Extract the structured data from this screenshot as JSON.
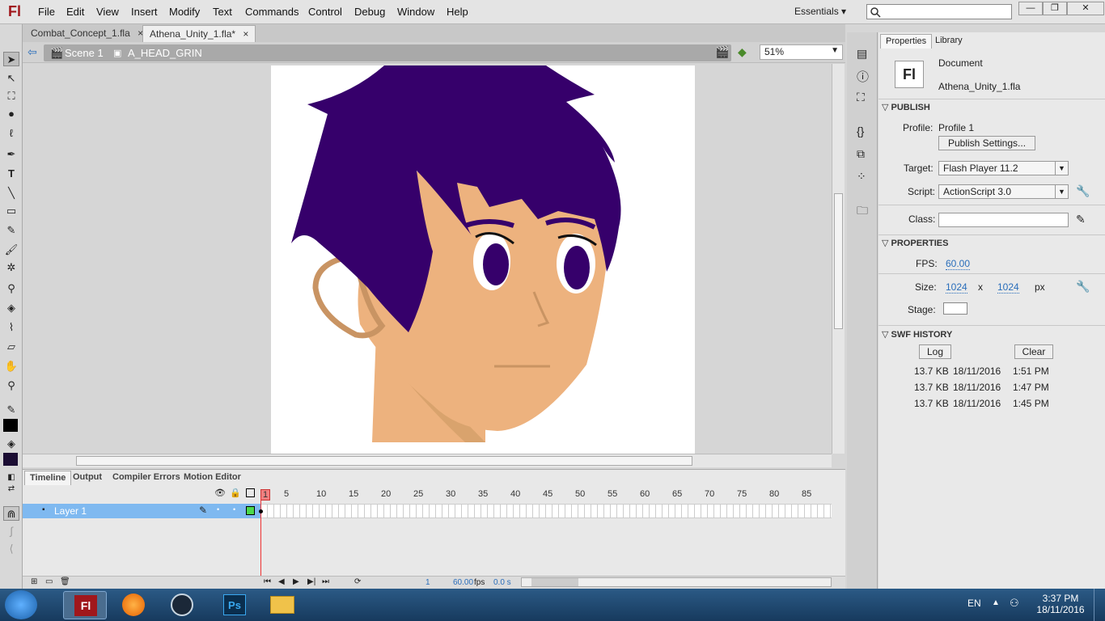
{
  "app": {
    "logo": "Fl"
  },
  "menu": [
    "File",
    "Edit",
    "View",
    "Insert",
    "Modify",
    "Text",
    "Commands",
    "Control",
    "Debug",
    "Window",
    "Help"
  ],
  "workspace": {
    "label": "Essentials"
  },
  "window_controls": {
    "minimize": "—",
    "restore": "❐",
    "close": "✕"
  },
  "tabs": [
    {
      "label": "Combat_Concept_1.fla",
      "close": "×"
    },
    {
      "label": "Athena_Unity_1.fla*",
      "close": "×"
    }
  ],
  "breadcrumb": {
    "scene": "Scene 1",
    "symbol": "A_HEAD_GRIN"
  },
  "zoom": {
    "value": "51%"
  },
  "timeline": {
    "tabs": [
      "Timeline",
      "Output",
      "Compiler Errors",
      "Motion Editor"
    ],
    "frame_numbers": [
      "1",
      "5",
      "10",
      "15",
      "20",
      "25",
      "30",
      "35",
      "40",
      "45",
      "50",
      "55",
      "60",
      "65",
      "70",
      "75",
      "80",
      "85"
    ],
    "layer_name": "Layer 1",
    "footer": {
      "frame": "1",
      "fps": "60.00",
      "fps_unit": "fps",
      "time": "0.0 s"
    }
  },
  "properties": {
    "tabs": [
      "Properties",
      "Library"
    ],
    "doc_type": "Document",
    "doc_name": "Athena_Unity_1.fla",
    "publish_header": "PUBLISH",
    "profile_label": "Profile:",
    "profile_value": "Profile 1",
    "publish_settings_button": "Publish Settings...",
    "target_label": "Target:",
    "target_value": "Flash Player 11.2",
    "script_label": "Script:",
    "script_value": "ActionScript 3.0",
    "class_label": "Class:",
    "properties_header": "PROPERTIES",
    "fps_label": "FPS:",
    "fps_value": "60.00",
    "size_label": "Size:",
    "size_w": "1024",
    "size_x": "x",
    "size_h": "1024",
    "size_unit": "px",
    "stage_label": "Stage:",
    "swf_header": "SWF HISTORY",
    "log_button": "Log",
    "clear_button": "Clear",
    "history": [
      {
        "size": "13.7 KB",
        "date": "18/11/2016",
        "time": "1:51 PM"
      },
      {
        "size": "13.7 KB",
        "date": "18/11/2016",
        "time": "1:47 PM"
      },
      {
        "size": "13.7 KB",
        "date": "18/11/2016",
        "time": "1:45 PM"
      }
    ]
  },
  "taskbar": {
    "lang": "EN",
    "time": "3:37 PM",
    "date": "18/11/2016",
    "apps": [
      {
        "name": "flash-icon",
        "color": "#a0171c",
        "label": "Fl"
      },
      {
        "name": "firefox-icon",
        "color": "#e66000",
        "label": ""
      },
      {
        "name": "steam-icon",
        "color": "#1b2838",
        "label": ""
      },
      {
        "name": "photoshop-icon",
        "color": "#0a2e4e",
        "label": "Ps"
      },
      {
        "name": "explorer-icon",
        "color": "#f0c24a",
        "label": ""
      }
    ]
  },
  "colors": {
    "hair": "#36006b",
    "skin": "#edb27e",
    "ear": "#d09a64",
    "pupil": "#36006b",
    "accent_blue": "#2a6ebb"
  }
}
